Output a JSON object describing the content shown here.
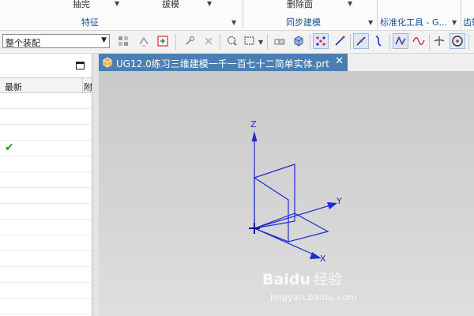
{
  "ribbon": {
    "top_items": [
      {
        "label": "抽完"
      },
      {
        "label": "拔模"
      },
      {
        "label": "删除面"
      }
    ],
    "groups": [
      {
        "label": "特征"
      },
      {
        "label": "同步建模"
      },
      {
        "label": "标准化工具 - G..."
      },
      {
        "label": "齿轮"
      }
    ]
  },
  "toolbar": {
    "selection_filter": "整个装配",
    "icons": [
      "feature-select-icon",
      "snap-arrows-icon",
      "component-icon",
      "wrench-icon",
      "settings-gear-icon",
      "circle-select-icon",
      "rectangle-select-icon",
      "eraser-icon",
      "cube-icon",
      "point-snap-icon",
      "line-icon",
      "line-diagonal-icon",
      "curve-icon",
      "spline-point-icon",
      "sine-curve-icon",
      "intersection-icon",
      "circle-center-icon"
    ]
  },
  "navigator": {
    "columns": [
      "最新",
      "附"
    ],
    "row_checked_index": 3
  },
  "document_tab": {
    "title": "UG12.0练习三维建模一千一百七十二简单实体.prt",
    "close_glyph": "✕"
  },
  "viewport": {
    "axes": {
      "z": "Z",
      "y": "Y",
      "x": "X"
    },
    "colors": {
      "axis": "#1f2bd0",
      "background_top": "#c9c9c9",
      "background_bottom": "#dedede"
    }
  },
  "watermark": {
    "logo": "Baidu",
    "suffix": "经验",
    "url": "jingyan.baidu.com"
  },
  "theme": {
    "accent": "#4a7fb3",
    "check_color": "#22a022"
  }
}
